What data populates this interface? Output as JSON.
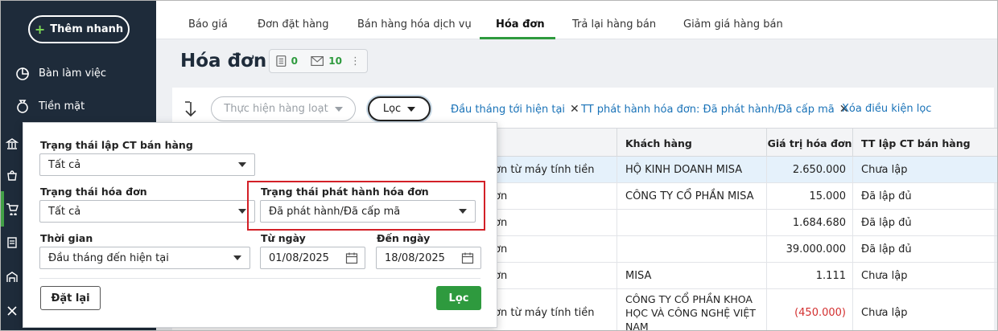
{
  "sidebar": {
    "quick_add_label": "Thêm nhanh",
    "items": [
      {
        "label": "Bàn làm việc",
        "icon": "dashboard-icon"
      },
      {
        "label": "Tiền mặt",
        "icon": "money-bag-icon"
      }
    ]
  },
  "tabs": [
    {
      "label": "Báo giá"
    },
    {
      "label": "Đơn đặt hàng"
    },
    {
      "label": "Bán hàng hóa dịch vụ"
    },
    {
      "label": "Hóa đơn",
      "active": true
    },
    {
      "label": "Trả lại hàng bán"
    },
    {
      "label": "Giảm giá hàng bán"
    }
  ],
  "page": {
    "title": "Hóa đơn",
    "doc_count": "0",
    "mail_count": "10"
  },
  "toolbar": {
    "bulk_action_label": "Thực hiện hàng loạt",
    "filter_label": "Lọc",
    "chips": [
      "Đầu tháng tới hiện tại",
      "TT phát hành hóa đơn: Đã phát hành/Đã cấp mã"
    ],
    "clear_filters_label": "Xóa điều kiện lọc"
  },
  "table": {
    "headers": {
      "customer": "Khách hàng",
      "invoice_value": "Giá trị hóa đơn",
      "sales_status": "TT lập CT bán hàng"
    },
    "rows": [
      {
        "desc": "ơn từ máy tính tiền",
        "customer": "HỘ KINH DOANH MISA",
        "value": "2.650.000",
        "status": "Chưa lập",
        "selected": true
      },
      {
        "desc": "ơn",
        "customer": "CÔNG TY CỔ PHẦN MISA",
        "value": "15.000",
        "status": "Đã lập đủ"
      },
      {
        "desc": "ơn",
        "customer": "",
        "value": "1.684.680",
        "status": "Đã lập đủ"
      },
      {
        "desc": "ơn",
        "customer": "",
        "value": "39.000.000",
        "status": "Đã lập đủ"
      },
      {
        "desc": "ơn",
        "customer": "MISA",
        "value": "1.111",
        "status": "Chưa lập"
      },
      {
        "desc": "ơn từ máy tính tiền",
        "customer_lines": [
          "CÔNG TY CỔ PHẦN KHOA",
          "HỌC VÀ CÔNG NGHỆ VIỆT",
          "NAM"
        ],
        "value": "(450.000)",
        "status": "Chưa lập",
        "negative": true
      }
    ]
  },
  "filter_panel": {
    "sales_doc_status_label": "Trạng thái lập CT bán hàng",
    "sales_doc_status_value": "Tất cả",
    "invoice_status_label": "Trạng thái hóa đơn",
    "invoice_status_value": "Tất cả",
    "issue_status_label": "Trạng thái phát hành hóa đơn",
    "issue_status_value": "Đã phát hành/Đã cấp mã",
    "period_label": "Thời gian",
    "period_value": "Đầu tháng đến hiện tại",
    "from_label": "Từ ngày",
    "from_value": "01/08/2025",
    "to_label": "Đến ngày",
    "to_value": "18/08/2025",
    "reset_label": "Đặt lại",
    "apply_label": "Lọc"
  },
  "colors": {
    "sidebar_bg": "#1e2b3a",
    "accent_green": "#2e9a3e",
    "link_blue": "#1a73b8",
    "highlight_red": "#d32027"
  }
}
